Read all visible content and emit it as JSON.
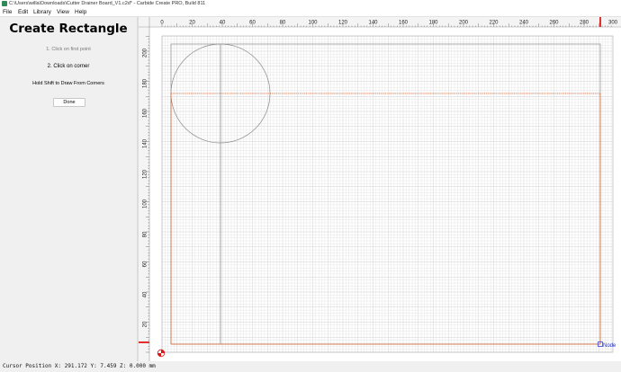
{
  "window": {
    "title": "C:\\Users\\willa\\Downloads\\Cutter Drainer Board_V1.c2d* - Carbide Create PRO, Build 811",
    "icon": "carbide-create-app-icon"
  },
  "menu": {
    "file": "File",
    "edit": "Edit",
    "library": "Library",
    "view": "View",
    "help": "Help"
  },
  "panel": {
    "title": "Create Rectangle",
    "step1": "1. Click on first point",
    "step2": "2. Click on corner",
    "hint": "Hold Shift to Draw From Corners",
    "done": "Done"
  },
  "rulers": {
    "top_labels": [
      "0",
      "20",
      "40",
      "60",
      "80",
      "100",
      "120",
      "140",
      "160",
      "180",
      "200",
      "220",
      "240",
      "260",
      "280",
      "300"
    ],
    "left_labels": [
      "200",
      "180",
      "160",
      "140",
      "120",
      "100",
      "80",
      "60",
      "40",
      "20"
    ]
  },
  "canvas": {
    "node_label": "Node",
    "colors": {
      "grid_minor": "#e6e6e6",
      "grid_major": "#d2d2d2",
      "stock_outline": "#909090",
      "rectangle_preview": "#e06a30",
      "circle": "#8a8a8a",
      "node_marker": "#1d2fd6",
      "origin": "#d91a1a",
      "ruler_cursor": "#e03030"
    }
  },
  "status": {
    "cursor_position": "Cursor Position X: 291.172 Y: 7.459 Z: 0.000 mm"
  }
}
